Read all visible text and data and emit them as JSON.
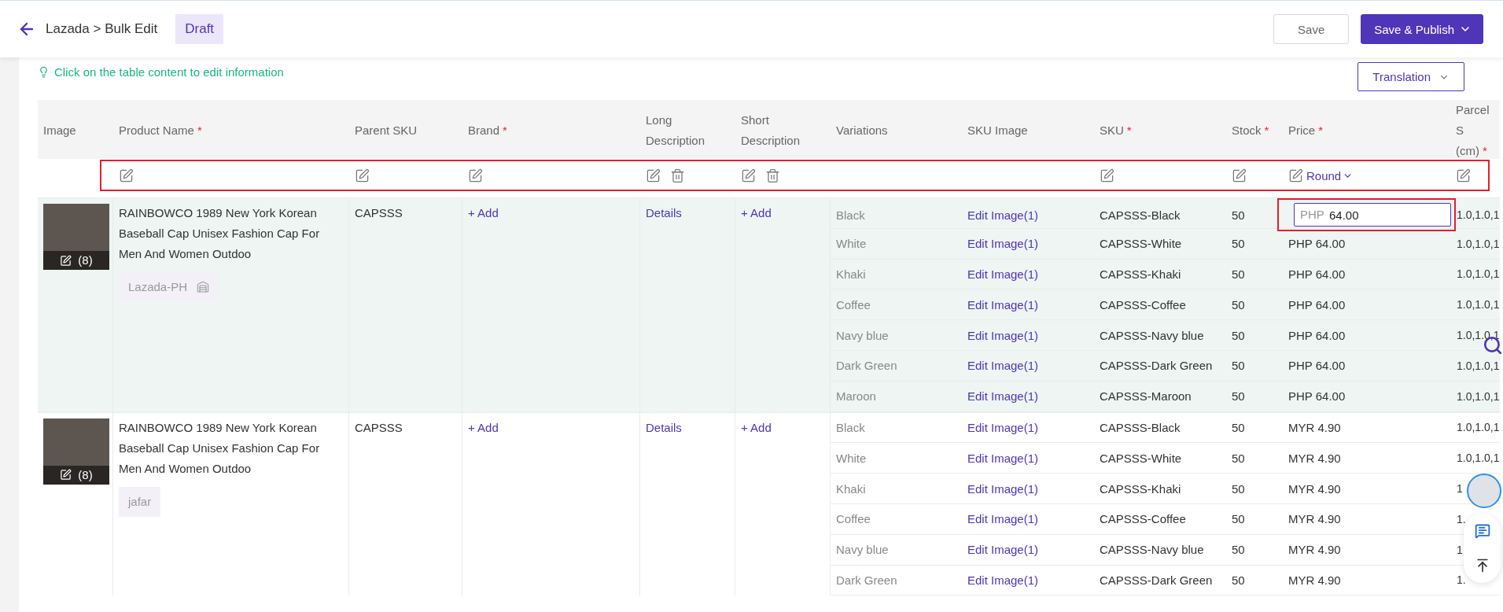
{
  "header": {
    "breadcrumb": "Lazada > Bulk Edit",
    "status": "Draft",
    "buttons": [
      {
        "label": "Save",
        "kind": "secondary"
      },
      {
        "label": "Save & Publish",
        "kind": "primary"
      }
    ]
  },
  "hint": "Click on the table content to edit information",
  "translation_button": "Translation",
  "table": {
    "columns": [
      {
        "label": "Image"
      },
      {
        "label": "Product Name",
        "required_mark": "*",
        "bulk_edit": true
      },
      {
        "label": "Parent SKU",
        "bulk_edit": true
      },
      {
        "label": "Brand",
        "required_mark": "*",
        "bulk_edit": true
      },
      {
        "label": "Long Description",
        "bulk_edit": true,
        "bulk_delete": true
      },
      {
        "label": "Short Description",
        "bulk_edit": true,
        "bulk_delete": true
      },
      {
        "label": "Variations"
      },
      {
        "label": "SKU Image"
      },
      {
        "label": "SKU",
        "required_mark": "*",
        "bulk_edit": true
      },
      {
        "label": "Stock",
        "required_mark": "*",
        "bulk_edit": true
      },
      {
        "label": "Price",
        "required_mark": "*",
        "bulk_edit": true,
        "bulk_menu": "Round"
      },
      {
        "label": "Parcel S (cm)",
        "required_mark": "*",
        "bulk_edit": true
      }
    ],
    "bulk_row_highlighted": true,
    "products": [
      {
        "selected": true,
        "image_count": "(8)",
        "name": "RAINBOWCO 1989 New York Korean Baseball Cap Unisex Fashion Cap For Men And Women Outdoo",
        "store": "Lazada-PH",
        "store_icon": true,
        "parent_sku": "CAPSSS",
        "brand": "+ Add",
        "long_description": "Details",
        "short_description": "+ Add",
        "variations": [
          {
            "name": "Black",
            "sku_image": "Edit Image(1)",
            "sku": "CAPSSS-Black",
            "stock": "50",
            "price_input": {
              "prefix": "PHP",
              "value": "64.00",
              "highlighted": true
            },
            "parcel": "1.0,1.0,1"
          },
          {
            "name": "White",
            "sku_image": "Edit Image(1)",
            "sku": "CAPSSS-White",
            "stock": "50",
            "price": "PHP 64.00",
            "parcel": "1.0,1.0,1"
          },
          {
            "name": "Khaki",
            "sku_image": "Edit Image(1)",
            "sku": "CAPSSS-Khaki",
            "stock": "50",
            "price": "PHP 64.00",
            "parcel": "1.0,1.0,1"
          },
          {
            "name": "Coffee",
            "sku_image": "Edit Image(1)",
            "sku": "CAPSSS-Coffee",
            "stock": "50",
            "price": "PHP 64.00",
            "parcel": "1.0,1.0,1"
          },
          {
            "name": "Navy blue",
            "sku_image": "Edit Image(1)",
            "sku": "CAPSSS-Navy blue",
            "stock": "50",
            "price": "PHP 64.00",
            "parcel": "1.0,1.0,1"
          },
          {
            "name": "Dark Green",
            "sku_image": "Edit Image(1)",
            "sku": "CAPSSS-Dark Green",
            "stock": "50",
            "price": "PHP 64.00",
            "parcel": "1.0,1.0,1"
          },
          {
            "name": "Maroon",
            "sku_image": "Edit Image(1)",
            "sku": "CAPSSS-Maroon",
            "stock": "50",
            "price": "PHP 64.00",
            "parcel": "1.0,1.0,1"
          }
        ]
      },
      {
        "selected": false,
        "image_count": "(8)",
        "name": "RAINBOWCO 1989 New York Korean Baseball Cap Unisex Fashion Cap For Men And Women Outdoo",
        "store": "jafar",
        "store_icon": false,
        "parent_sku": "CAPSSS",
        "brand": "+ Add",
        "long_description": "Details",
        "short_description": "+ Add",
        "variations": [
          {
            "name": "Black",
            "sku_image": "Edit Image(1)",
            "sku": "CAPSSS-Black",
            "stock": "50",
            "price": "MYR 4.90",
            "parcel": "1.0,1.0,1"
          },
          {
            "name": "White",
            "sku_image": "Edit Image(1)",
            "sku": "CAPSSS-White",
            "stock": "50",
            "price": "MYR 4.90",
            "parcel": "1.0,1.0,1"
          },
          {
            "name": "Khaki",
            "sku_image": "Edit Image(1)",
            "sku": "CAPSSS-Khaki",
            "stock": "50",
            "price": "MYR 4.90",
            "parcel": "1"
          },
          {
            "name": "Coffee",
            "sku_image": "Edit Image(1)",
            "sku": "CAPSSS-Coffee",
            "stock": "50",
            "price": "MYR 4.90",
            "parcel": "1."
          },
          {
            "name": "Navy blue",
            "sku_image": "Edit Image(1)",
            "sku": "CAPSSS-Navy blue",
            "stock": "50",
            "price": "MYR 4.90",
            "parcel": "1"
          },
          {
            "name": "Dark Green",
            "sku_image": "Edit Image(1)",
            "sku": "CAPSSS-Dark Green",
            "stock": "50",
            "price": "MYR 4.90",
            "parcel": "1."
          }
        ]
      }
    ]
  }
}
